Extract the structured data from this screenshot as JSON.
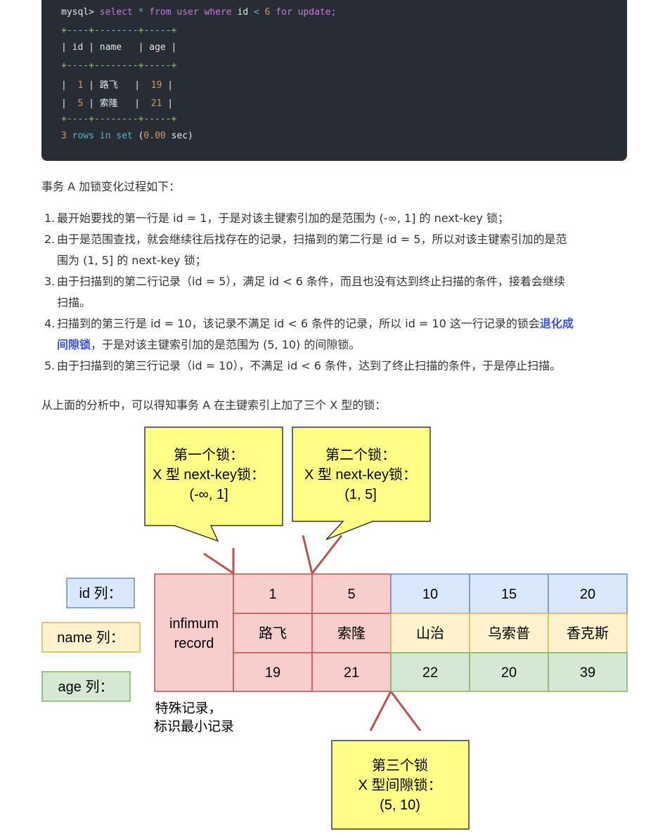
{
  "code_block": {
    "query_prompt": "mysql>",
    "query_select": "select",
    "query_star": "*",
    "query_from": "from",
    "query_table": "user",
    "query_where": "where",
    "query_col": "id",
    "query_lt": "<",
    "query_val": "6",
    "query_for": "for",
    "query_update": "update;",
    "border": "+----+--------+-----+",
    "columns": [
      "id",
      "name",
      "age"
    ],
    "rows": [
      {
        "id": "1",
        "name": "路飞",
        "age": "19"
      },
      {
        "id": "5",
        "name": "索隆",
        "age": "21"
      }
    ],
    "footer_count": "3",
    "footer_rows": "rows",
    "footer_in": "in",
    "footer_set": "set",
    "footer_time_open": "(",
    "footer_time": "0.00",
    "footer_time_close": "sec)"
  },
  "intro_text": "事务 A 加锁变化过程如下：",
  "steps": [
    {
      "index": "1.",
      "lines": [
        "最开始要找的第一行是 id = 1，于是对该主键索引加的是范围为 (-∞, 1] 的 next-key 锁；"
      ]
    },
    {
      "index": "2.",
      "lines": [
        "由于是范围查找，就会继续往后找存在的记录，扫描到的第二行是 id = 5，所以对该主键索引加的是范",
        "围为 (1, 5] 的 next-key 锁；"
      ]
    },
    {
      "index": "3.",
      "lines": [
        "由于扫描到的第二行记录（id = 5），满足 id < 6 条件，而且也没有达到终止扫描的条件，接着会继续",
        "扫描。"
      ]
    },
    {
      "index": "4.",
      "line1_pre": "扫描到的第三行是 id = 10，该记录不满足 id < 6 条件的记录，所以 id = 10 这一行记录的锁会",
      "line1_bold": "退化成",
      "line2_bold": "间隙锁",
      "line2_post": "，于是对该主键索引加的是范围为 (5, 10) 的间隙锁。"
    },
    {
      "index": "5.",
      "lines": [
        "由于扫描到的第三行记录（id = 10），不满足 id < 6 条件，达到了终止扫描的条件，于是停止扫描。"
      ]
    }
  ],
  "summary_text": "从上面的分析中，可以得知事务 A 在主键索引上加了三个 X 型的锁：",
  "diagram": {
    "callout_1": [
      "第一个锁：",
      "X 型 next-key锁：",
      "(-∞, 1]"
    ],
    "callout_2": [
      "第二个锁：",
      "X 型 next-key锁：",
      "(1, 5]"
    ],
    "callout_3": [
      "第三个锁",
      "X 型间隙锁：",
      "(5, 10)"
    ],
    "legend": {
      "id": "id 列：",
      "name": "name 列：",
      "age": "age 列："
    },
    "infimum": [
      "infimum",
      "record"
    ],
    "infimum_note": [
      "特殊记录，",
      "标识最小记录"
    ],
    "records": [
      {
        "id": "1",
        "name": "路飞",
        "age": "19"
      },
      {
        "id": "5",
        "name": "索隆",
        "age": "21"
      },
      {
        "id": "10",
        "name": "山治",
        "age": "22"
      },
      {
        "id": "15",
        "name": "乌索普",
        "age": "20"
      },
      {
        "id": "20",
        "name": "香克斯",
        "age": "39"
      }
    ],
    "colors": {
      "callout_fill": "#ffff88",
      "locked_fill": "#f8cecc",
      "id_fill": "#dae8fc",
      "name_fill": "#fff2cc",
      "age_fill": "#d5e8d4",
      "arrow": "#b85450"
    }
  }
}
